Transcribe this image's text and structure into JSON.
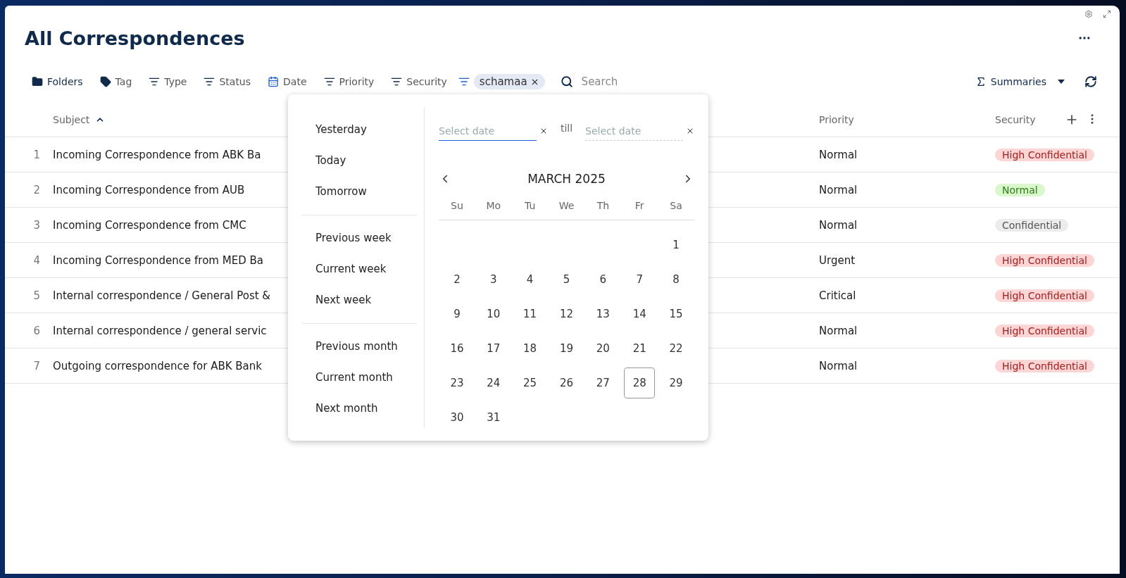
{
  "title": "All Correspondences",
  "toolbar": {
    "filters": [
      {
        "label": "Folders",
        "kind": "folder",
        "active": false
      },
      {
        "label": "Tag",
        "kind": "tag",
        "active": false
      },
      {
        "label": "Type",
        "kind": "filter",
        "active": false
      },
      {
        "label": "Status",
        "kind": "filter",
        "active": false
      },
      {
        "label": "Date",
        "kind": "calendar",
        "active": true
      },
      {
        "label": "Priority",
        "kind": "filter",
        "active": false
      },
      {
        "label": "Security",
        "kind": "filter",
        "active": false
      }
    ],
    "chip": {
      "label": "schamaa"
    },
    "search": {
      "placeholder": "Search"
    },
    "summaries": "Summaries"
  },
  "table": {
    "columns": [
      {
        "label": "Subject",
        "sorted": true
      },
      {
        "label": "Priority",
        "sorted": false
      },
      {
        "label": "Security",
        "sorted": false
      }
    ],
    "rows": [
      {
        "number": "1",
        "subject": "Incoming Correspondence from ABK Ba",
        "priority": "Normal",
        "security": {
          "label": "High Confidential",
          "kind": "high"
        }
      },
      {
        "number": "2",
        "subject": "Incoming Correspondence from AUB",
        "priority": "Normal",
        "security": {
          "label": "Normal",
          "kind": "normal"
        }
      },
      {
        "number": "3",
        "subject": "Incoming Correspondence from CMC",
        "priority": "Normal",
        "security": {
          "label": "Confidential",
          "kind": "confidential"
        }
      },
      {
        "number": "4",
        "subject": "Incoming Correspondence from MED Ba",
        "priority": "Urgent",
        "security": {
          "label": "High Confidential",
          "kind": "high"
        }
      },
      {
        "number": "5",
        "subject": "Internal correspondence / General Post &",
        "priority": "Critical",
        "security": {
          "label": "High Confidential",
          "kind": "high"
        }
      },
      {
        "number": "6",
        "subject": "Internal correspondence / general servic",
        "priority": "Normal",
        "security": {
          "label": "High Confidential",
          "kind": "high"
        }
      },
      {
        "number": "7",
        "subject": "Outgoing correspondence for ABK Bank",
        "priority": "Normal",
        "security": {
          "label": "High Confidential",
          "kind": "high"
        }
      }
    ]
  },
  "date_picker": {
    "presets": [
      [
        "Yesterday",
        "Today",
        "Tomorrow"
      ],
      [
        "Previous week",
        "Current week",
        "Next week"
      ],
      [
        "Previous month",
        "Current month",
        "Next month"
      ]
    ],
    "from": {
      "placeholder": "Select date",
      "focused": true
    },
    "till_label": "till",
    "to": {
      "placeholder": "Select date",
      "focused": false
    },
    "month": "MARCH 2025",
    "weekdays": [
      "Su",
      "Mo",
      "Tu",
      "We",
      "Th",
      "Fr",
      "Sa"
    ],
    "weeks": [
      {
        "kind": "lead",
        "days": [
          {
            "label": "1",
            "today": false
          }
        ]
      },
      {
        "kind": "full",
        "days": [
          {
            "label": "2",
            "today": false
          },
          {
            "label": "3",
            "today": false
          },
          {
            "label": "4",
            "today": false
          },
          {
            "label": "5",
            "today": false
          },
          {
            "label": "6",
            "today": false
          },
          {
            "label": "7",
            "today": false
          },
          {
            "label": "8",
            "today": false
          }
        ]
      },
      {
        "kind": "full",
        "days": [
          {
            "label": "9",
            "today": false
          },
          {
            "label": "10",
            "today": false
          },
          {
            "label": "11",
            "today": false
          },
          {
            "label": "12",
            "today": false
          },
          {
            "label": "13",
            "today": false
          },
          {
            "label": "14",
            "today": false
          },
          {
            "label": "15",
            "today": false
          }
        ]
      },
      {
        "kind": "full",
        "days": [
          {
            "label": "16",
            "today": false
          },
          {
            "label": "17",
            "today": false
          },
          {
            "label": "18",
            "today": false
          },
          {
            "label": "19",
            "today": false
          },
          {
            "label": "20",
            "today": false
          },
          {
            "label": "21",
            "today": false
          },
          {
            "label": "22",
            "today": false
          }
        ]
      },
      {
        "kind": "full",
        "days": [
          {
            "label": "23",
            "today": false
          },
          {
            "label": "24",
            "today": false
          },
          {
            "label": "25",
            "today": false
          },
          {
            "label": "26",
            "today": false
          },
          {
            "label": "27",
            "today": false
          },
          {
            "label": "28",
            "today": true
          },
          {
            "label": "29",
            "today": false
          }
        ]
      },
      {
        "kind": "tail",
        "days": [
          {
            "label": "30",
            "today": false
          },
          {
            "label": "31",
            "today": false
          }
        ]
      }
    ]
  }
}
